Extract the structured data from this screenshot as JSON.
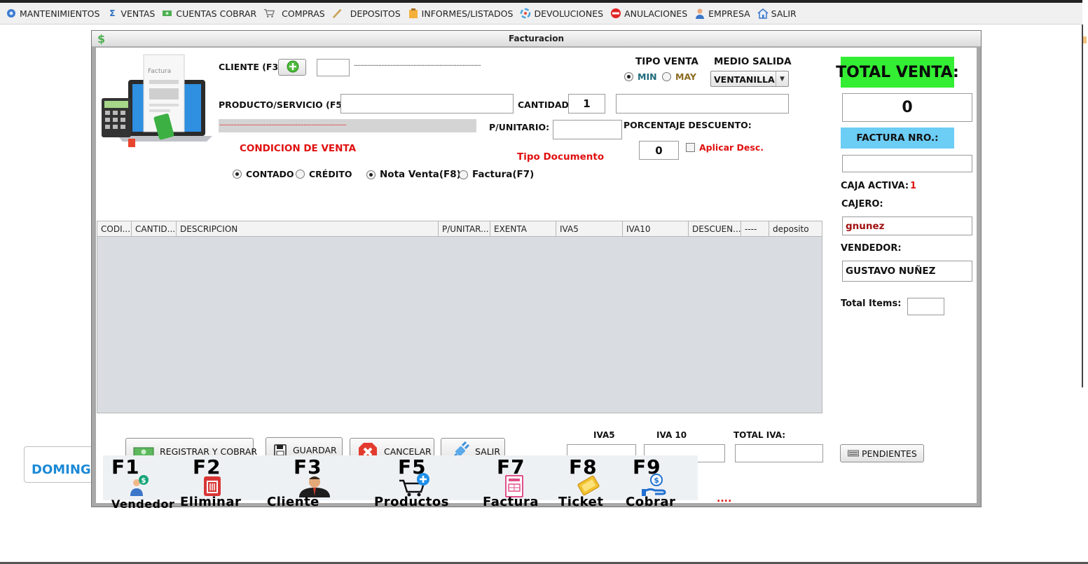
{
  "menubar": {
    "items": [
      {
        "label": "MANTENIMIENTOS",
        "icon": "gears-icon"
      },
      {
        "label": "VENTAS",
        "icon": "sigma-icon"
      },
      {
        "label": "CUENTAS COBRAR",
        "icon": "money-icon"
      },
      {
        "label": "COMPRAS",
        "icon": "cart-icon"
      },
      {
        "label": "DEPOSITOS",
        "icon": "pen-icon"
      },
      {
        "label": "INFORMES/LISTADOS",
        "icon": "clipboard-icon"
      },
      {
        "label": "DEVOLUCIONES",
        "icon": "refresh-icon"
      },
      {
        "label": "ANULACIONES",
        "icon": "stop-icon"
      },
      {
        "label": "EMPRESA",
        "icon": "user-icon"
      },
      {
        "label": "SALIR",
        "icon": "home-icon"
      }
    ]
  },
  "background": {
    "day": "DOMINGO"
  },
  "dialog": {
    "title": "Facturacion",
    "illustration_text": "Factura",
    "cliente_label": "CLIENTE (F3):",
    "cliente_code": "",
    "cliente_name_placeholder": "...................................................................................",
    "producto_label": "PRODUCTO/SERVICIO (F5):",
    "producto_value": "",
    "cantidad_label": "CANTIDAD",
    "cantidad_value": "1",
    "descripcion_value": "",
    "producto_name_placeholder": "...................................................................................",
    "punitario_label": "P/UNITARIO:",
    "punitario_value": "",
    "porcentaje_label": "PORCENTAJE DESCUENTO:",
    "porcentaje_value": "0",
    "aplicar_desc_label": "Aplicar Desc.",
    "tipo_venta_label": "TIPO VENTA",
    "tipo_venta_options": {
      "min": "MIN",
      "may": "MAY"
    },
    "medio_salida_label": "MEDIO SALIDA",
    "medio_salida_value": "VENTANILLA",
    "condicion_label": "CONDICION DE VENTA",
    "condicion_options": {
      "contado": "CONTADO",
      "credito": "CRÉDITO"
    },
    "tipo_documento_label": "Tipo Documento",
    "documento_options": {
      "nota": "Nota Venta(F8)",
      "factura": "Factura(F7)"
    },
    "table": {
      "columns": [
        "CODI...",
        "CANTID...",
        "DESCRIPCION",
        "P/UNITAR...",
        "EXENTA",
        "IVA5",
        "IVA10",
        "DESCUEN...",
        "----",
        "deposito"
      ],
      "rows": []
    },
    "buttons": {
      "registrar": "REGISTRAR Y COBRAR",
      "guardar": "GUARDAR",
      "cancelar": "CANCELAR",
      "salir": "SALIR",
      "pendientes": "PENDIENTES"
    },
    "iva": {
      "iva5_label": "IVA5",
      "iva10_label": "IVA 10",
      "total_label": "TOTAL IVA:",
      "iva5": "",
      "iva10": "",
      "total": ""
    },
    "summary": {
      "total_venta_label": "TOTAL VENTA:",
      "total_venta_value": "0",
      "factura_label": "FACTURA NRO.:",
      "factura_value": "",
      "caja_label": "CAJA ACTIVA:",
      "caja_value": "1",
      "cajero_label": "CAJERO:",
      "cajero_value": "gnunez",
      "vendedor_label": "VENDEDOR:",
      "vendedor_value": "GUSTAVO NUÑEZ",
      "total_items_label": "Total Items:",
      "total_items_value": ""
    },
    "shortcuts": [
      {
        "key": "F1",
        "name": "Vendedor",
        "icon": "seller-icon"
      },
      {
        "key": "F2",
        "name": "Eliminar",
        "icon": "trash-icon"
      },
      {
        "key": "F3",
        "name": "Cliente",
        "icon": "client-icon"
      },
      {
        "key": "F5",
        "name": "Productos",
        "icon": "add-to-cart-icon"
      },
      {
        "key": "F7",
        "name": "Factura",
        "icon": "invoice-icon"
      },
      {
        "key": "F8",
        "name": "Ticket",
        "icon": "ticket-icon"
      },
      {
        "key": "F9",
        "name": "Cobrar",
        "icon": "payment-icon"
      }
    ],
    "shortcuts_more": "...."
  },
  "colors": {
    "total_venta_bg": "#33ee33",
    "factura_bg": "#6ccdf5",
    "accent_red": "#e01010",
    "day_blue": "#1b8ad6"
  }
}
